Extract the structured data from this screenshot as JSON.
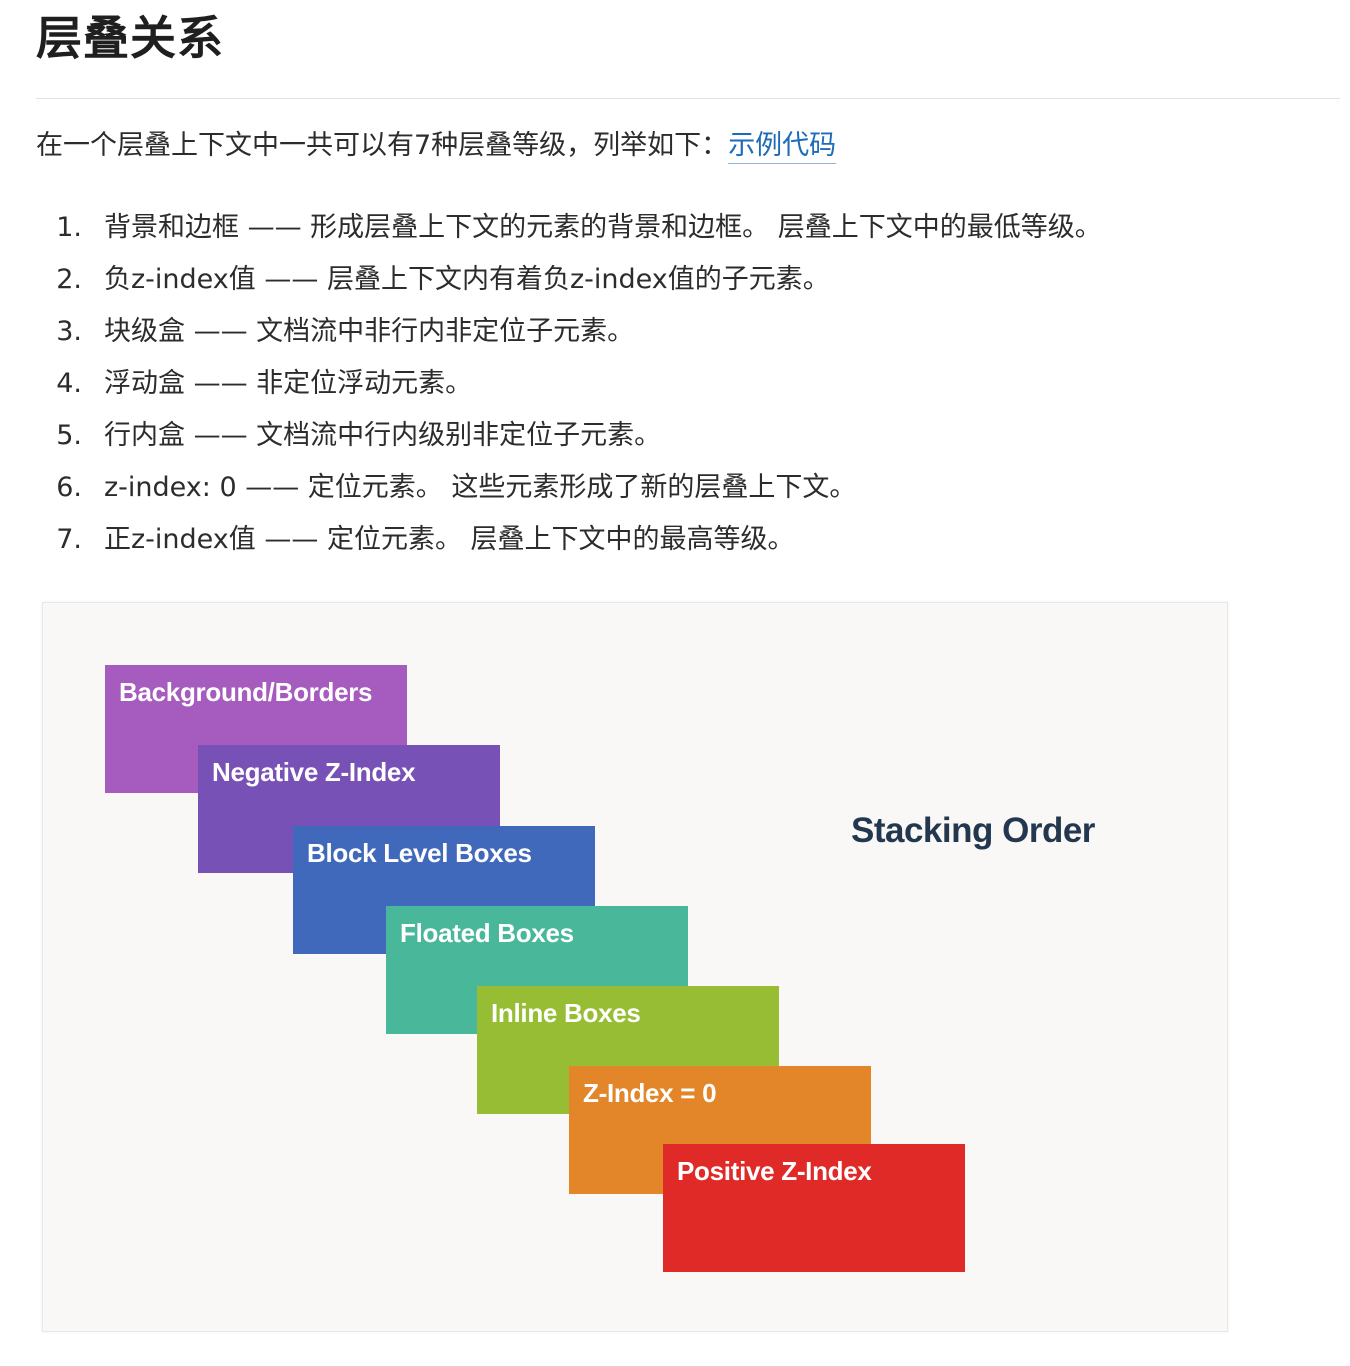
{
  "title": "层叠关系",
  "intro": {
    "text": "在一个层叠上下文中一共可以有7种层叠等级，列举如下：",
    "link": "示例代码"
  },
  "levels": [
    {
      "num": "1.",
      "text": "背景和边框 —— 形成层叠上下文的元素的背景和边框。 层叠上下文中的最低等级。"
    },
    {
      "num": "2.",
      "text": "负z-index值 —— 层叠上下文内有着负z-index值的子元素。"
    },
    {
      "num": "3.",
      "text": "块级盒 —— 文档流中非行内非定位子元素。"
    },
    {
      "num": "4.",
      "text": "浮动盒 —— 非定位浮动元素。"
    },
    {
      "num": "5.",
      "text": "行内盒 —— 文档流中行内级别非定位子元素。"
    },
    {
      "num": "6.",
      "text": "z-index: 0 —— 定位元素。 这些元素形成了新的层叠上下文。"
    },
    {
      "num": "7.",
      "text": "正z-index值 —— 定位元素。 层叠上下文中的最高等级。"
    }
  ],
  "figure": {
    "heading": "Stacking Order",
    "layers": [
      {
        "label": "Background/Borders",
        "color": "#a65bbf"
      },
      {
        "label": "Negative Z-Index",
        "color": "#7751b6"
      },
      {
        "label": "Block Level Boxes",
        "color": "#4169bb"
      },
      {
        "label": "Floated Boxes",
        "color": "#48b79a"
      },
      {
        "label": "Inline Boxes",
        "color": "#96bd34"
      },
      {
        "label": "Z-Index = 0",
        "color": "#e3862a"
      },
      {
        "label": "Positive Z-Index",
        "color": "#e02a28"
      }
    ]
  }
}
